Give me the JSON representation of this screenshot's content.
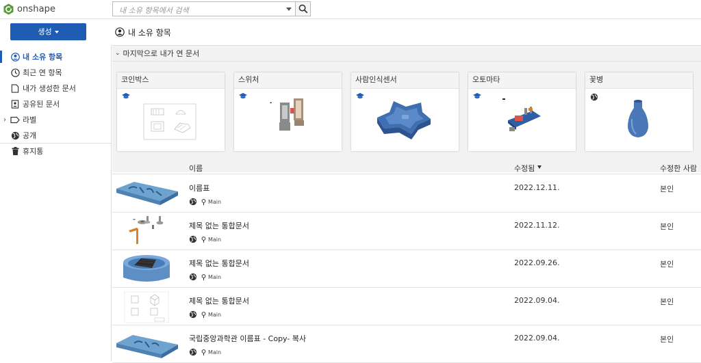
{
  "brand": {
    "name": "onshape",
    "color": "#5a9a3a"
  },
  "search": {
    "placeholder": "내 소유 항목에서 검색"
  },
  "create": {
    "label": "생성"
  },
  "page": {
    "title": "내 소유 항목"
  },
  "sidebar": {
    "items": [
      {
        "label": "내 소유 항목",
        "icon": "user-circle-icon",
        "active": true
      },
      {
        "label": "최근 연 항목",
        "icon": "clock-icon"
      },
      {
        "label": "내가 생성한 문서",
        "icon": "document-icon"
      },
      {
        "label": "공유된 문서",
        "icon": "shared-doc-icon"
      },
      {
        "label": "라벨",
        "icon": "label-tag-icon"
      },
      {
        "label": "공개",
        "icon": "globe-icon"
      },
      {
        "label": "휴지통",
        "icon": "trash-icon"
      }
    ]
  },
  "recent": {
    "heading": "마지막으로 내가 연 문서",
    "cards": [
      {
        "title": "코인박스",
        "badge": "education-cap-icon"
      },
      {
        "title": "스위처",
        "badge": "education-cap-icon"
      },
      {
        "title": "사람인식센서",
        "badge": "education-cap-icon"
      },
      {
        "title": "오토마타",
        "badge": "education-cap-icon"
      },
      {
        "title": "꽃병",
        "badge": "globe-icon"
      }
    ]
  },
  "table": {
    "headers": {
      "name": "이름",
      "modified": "수정됨",
      "modified_by": "수정한 사람"
    },
    "rows": [
      {
        "name": "이름표",
        "branch": "Main",
        "date": "2022.12.11.",
        "by": "본인"
      },
      {
        "name": "제목 없는 통합문서",
        "branch": "Main",
        "date": "2022.11.12.",
        "by": "본인"
      },
      {
        "name": "제목 없는 통합문서",
        "branch": "Main",
        "date": "2022.09.26.",
        "by": "본인"
      },
      {
        "name": "제목 없는 통합문서",
        "branch": "Main",
        "date": "2022.09.04.",
        "by": "본인"
      },
      {
        "name": "국립중앙과학관 이름표 - Copy- 복사",
        "branch": "Main",
        "date": "2022.09.04.",
        "by": "본인"
      }
    ]
  },
  "colors": {
    "accent": "#1f5db5",
    "part_blue": "#4a7fc0",
    "part_orange": "#d9822b"
  }
}
